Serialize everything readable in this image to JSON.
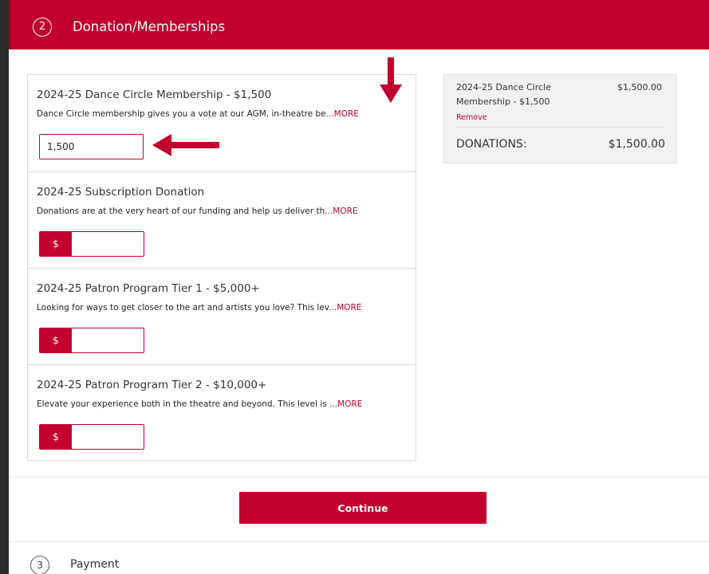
{
  "step2": {
    "number": "2",
    "title": "Donation/Memberships"
  },
  "items": [
    {
      "title": "2024-25 Dance Circle Membership - $1,500",
      "description": "Dance Circle membership gives you a vote at our AGM, in-theatre be",
      "more": "...MORE",
      "input_value": "1,500"
    },
    {
      "title": "2024-25 Subscription Donation",
      "description": "Donations are at the very heart of our funding and help us deliver th",
      "more": "...MORE",
      "prefix": "$",
      "input_value": ""
    },
    {
      "title": "2024-25 Patron Program Tier 1 - $5,000+",
      "description": "Looking for ways to get closer to the art and artists you love? This lev",
      "more": "...MORE",
      "prefix": "$",
      "input_value": ""
    },
    {
      "title": "2024-25 Patron Program Tier 2 - $10,000+",
      "description": "Elevate your experience both in the theatre and beyond. This level is ",
      "more": "...MORE",
      "prefix": "$",
      "input_value": ""
    }
  ],
  "summary": {
    "item_name": "2024-25 Dance Circle Membership - $1,500",
    "item_price": "$1,500.00",
    "remove_label": "Remove",
    "total_label": "DONATIONS:",
    "total_value": "$1,500.00"
  },
  "continue_label": "Continue",
  "step3": {
    "number": "3",
    "title": "Payment"
  },
  "colors": {
    "accent": "#c2002f",
    "summary_bg": "#f2f2f2"
  },
  "annotations": [
    "arrow-down",
    "arrow-left"
  ]
}
